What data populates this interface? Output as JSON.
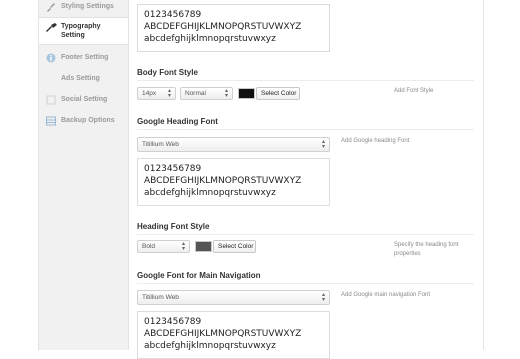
{
  "sidebar": {
    "items": [
      {
        "label": "Styling Settings",
        "icon": "brush-icon"
      },
      {
        "label_line1": "Typography",
        "label_line2": "Setting",
        "icon": "typography-icon"
      },
      {
        "label": "Footer Setting",
        "icon": "info-icon"
      },
      {
        "label": "Ads Setting",
        "icon": ""
      },
      {
        "label": "Social Setting",
        "icon": "social-icon"
      },
      {
        "label": "Backup Options",
        "icon": "backup-icon"
      }
    ]
  },
  "sample": {
    "digits": "0123456789",
    "upper": "ABCDEFGHIJKLMNOPQRSTUVWXYZ",
    "lower": "abcdefghijklmnopqrstuvwxyz"
  },
  "body_font_style": {
    "title": "Body Font Style",
    "size": "14px",
    "weight": "Normal",
    "color": "#111111",
    "button": "Select Color",
    "help": "Add Font Style"
  },
  "google_heading_font": {
    "title": "Google Heading Font",
    "value": "Titillium Web",
    "help": "Add Google heading Font"
  },
  "heading_font_style": {
    "title": "Heading Font Style",
    "weight": "Bold",
    "color": "#555555",
    "button": "Select Color",
    "help_line1": "Specify the heading font",
    "help_line2": "properties"
  },
  "google_nav_font": {
    "title": "Google Font for Main Navigation",
    "value": "Titillium Web",
    "help": "Add Google main navigation Font"
  }
}
